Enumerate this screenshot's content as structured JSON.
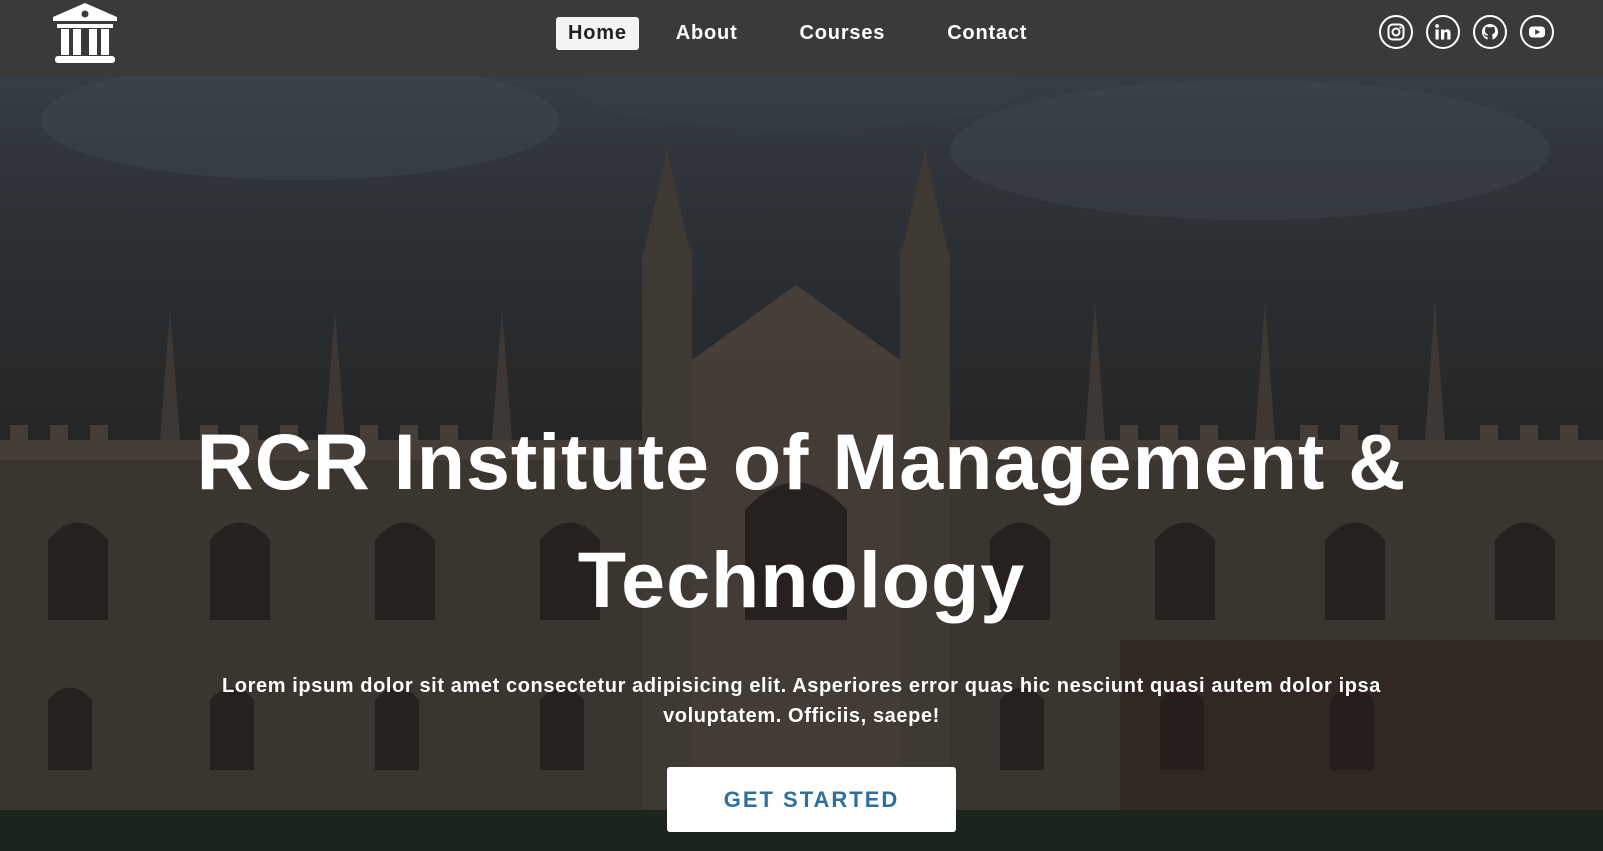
{
  "navbar": {
    "logo_icon": "institution-building-icon",
    "links": [
      {
        "label": "Home",
        "active": true
      },
      {
        "label": "About",
        "active": false
      },
      {
        "label": "Courses",
        "active": false
      },
      {
        "label": "Contact",
        "active": false
      }
    ],
    "socials": [
      {
        "icon": "instagram-icon"
      },
      {
        "icon": "linkedin-icon"
      },
      {
        "icon": "github-icon"
      },
      {
        "icon": "youtube-icon"
      }
    ]
  },
  "hero": {
    "background": "college-building-photo",
    "title": "RCR Institute of Management & Technology",
    "subtitle": "Lorem ipsum dolor sit amet consectetur adipisicing elit. Asperiores error quas hic nesciunt quasi autem dolor ipsa voluptatem. Officiis, saepe!",
    "cta_label": "GET STARTED"
  },
  "colors": {
    "navbar_bg": "#3a3a3a",
    "active_link_bg": "#f4f4f4",
    "cta_text": "#2f6f9d",
    "text": "#ffffff"
  }
}
